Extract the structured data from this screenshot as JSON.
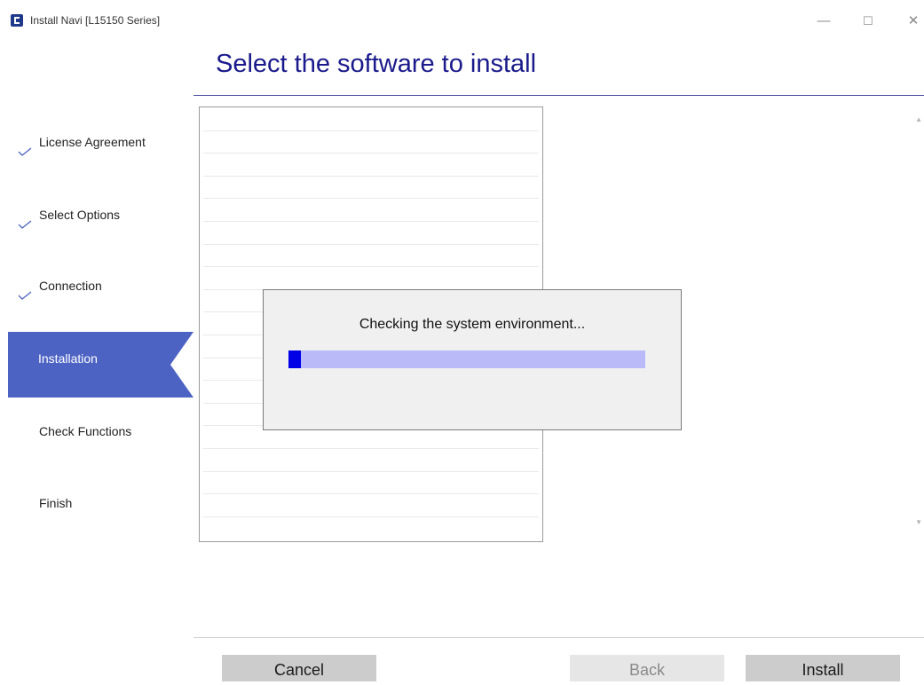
{
  "window": {
    "title": "Install Navi [L15150 Series]",
    "minimize_glyph": "—",
    "maximize_glyph": "☐",
    "close_glyph": "✕"
  },
  "page": {
    "heading": "Select the software to install"
  },
  "steps": [
    {
      "label": "License Agreement",
      "status": "done"
    },
    {
      "label": "Select Options",
      "status": "done"
    },
    {
      "label": "Connection",
      "status": "done"
    },
    {
      "label": "Installation",
      "status": "active"
    },
    {
      "label": "Check Functions",
      "status": "pending"
    },
    {
      "label": "Finish",
      "status": "pending"
    }
  ],
  "dialog": {
    "message": "Checking the system environment...",
    "progress": 0.035
  },
  "buttons": {
    "cancel": "Cancel",
    "back": "Back",
    "install": "Install"
  },
  "colors": {
    "accent": "#4d63c4",
    "heading": "#1a1a8c",
    "progress_fill": "#0000e6",
    "progress_track": "#babaf8"
  }
}
